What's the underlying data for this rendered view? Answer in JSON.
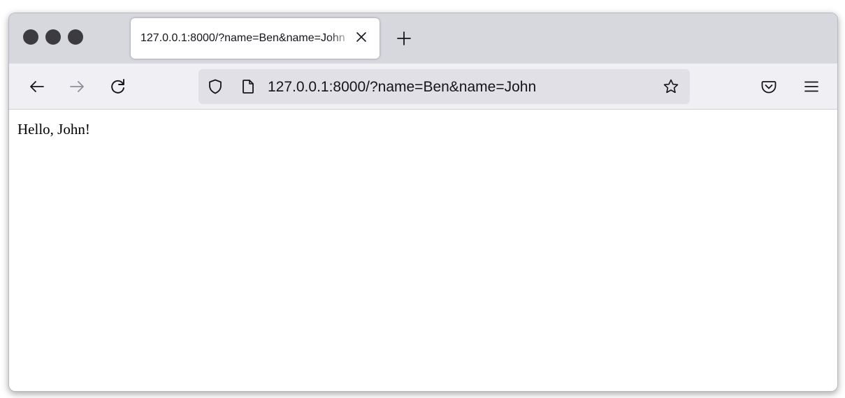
{
  "browser": {
    "tab": {
      "title": "127.0.0.1:8000/?name=Ben&name=John"
    },
    "address_bar": {
      "url": "127.0.0.1:8000/?name=Ben&name=John"
    },
    "icons": {
      "back": "back-arrow-icon",
      "forward": "forward-arrow-icon",
      "reload": "reload-icon",
      "shield": "shield-icon",
      "page": "page-icon",
      "bookmark": "star-icon",
      "pocket": "pocket-icon",
      "menu": "hamburger-menu-icon",
      "close_tab": "close-icon",
      "new_tab": "plus-icon"
    }
  },
  "page": {
    "greeting": "Hello, John!"
  }
}
